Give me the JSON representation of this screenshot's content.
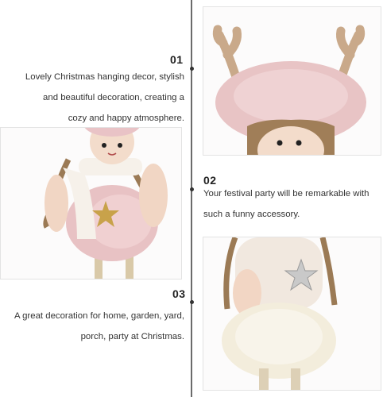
{
  "sections": [
    {
      "number": "01",
      "lines": [
        "Lovely Christmas hanging decor, stylish",
        "and beautiful decoration, creating a",
        "cozy and happy atmosphere."
      ]
    },
    {
      "number": "02",
      "lines": [
        "Your festival party will be remarkable with",
        "such a funny accessory."
      ]
    },
    {
      "number": "03",
      "lines": [
        "A great decoration for home, garden, yard,",
        "porch, party at Christmas."
      ]
    }
  ],
  "images": [
    {
      "name": "pink-angel-doll-photo"
    },
    {
      "name": "antler-hat-doll-photo"
    },
    {
      "name": "white-angel-doll-photo"
    }
  ]
}
